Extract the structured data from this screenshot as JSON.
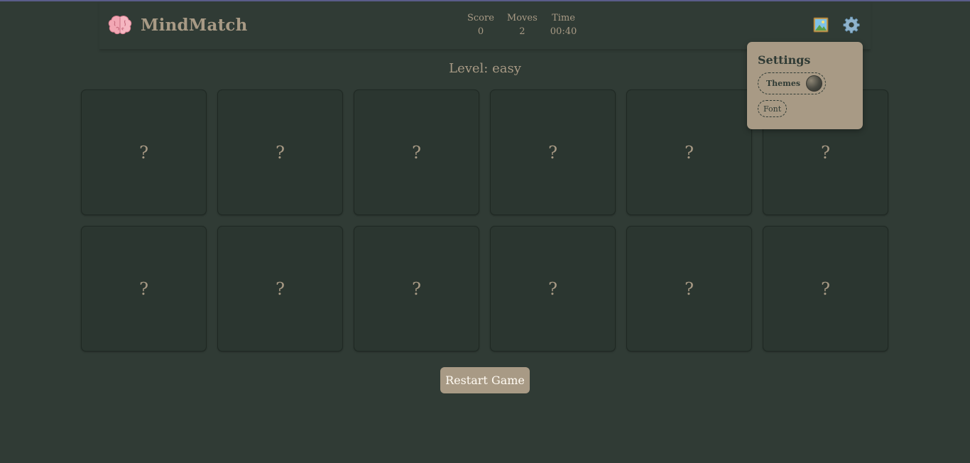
{
  "header": {
    "title": "MindMatch",
    "logo_icon": "brain-icon",
    "stats": [
      {
        "label": "Score",
        "value": "0"
      },
      {
        "label": "Moves",
        "value": "2"
      },
      {
        "label": "Time",
        "value": "00:40"
      }
    ],
    "buttons": {
      "gallery_icon": "picture-icon",
      "settings_icon": "gear-icon"
    }
  },
  "level": "Level: easy",
  "cards": [
    "?",
    "?",
    "?",
    "?",
    "?",
    "?",
    "?",
    "?",
    "?",
    "?",
    "?",
    "?"
  ],
  "restart_label": "Restart Game",
  "settings": {
    "title": "Settings",
    "themes_label": "Themes",
    "font_label": "Font"
  },
  "colors": {
    "background": "#303b35",
    "accent": "#a89a85",
    "card": "#2b3630"
  }
}
